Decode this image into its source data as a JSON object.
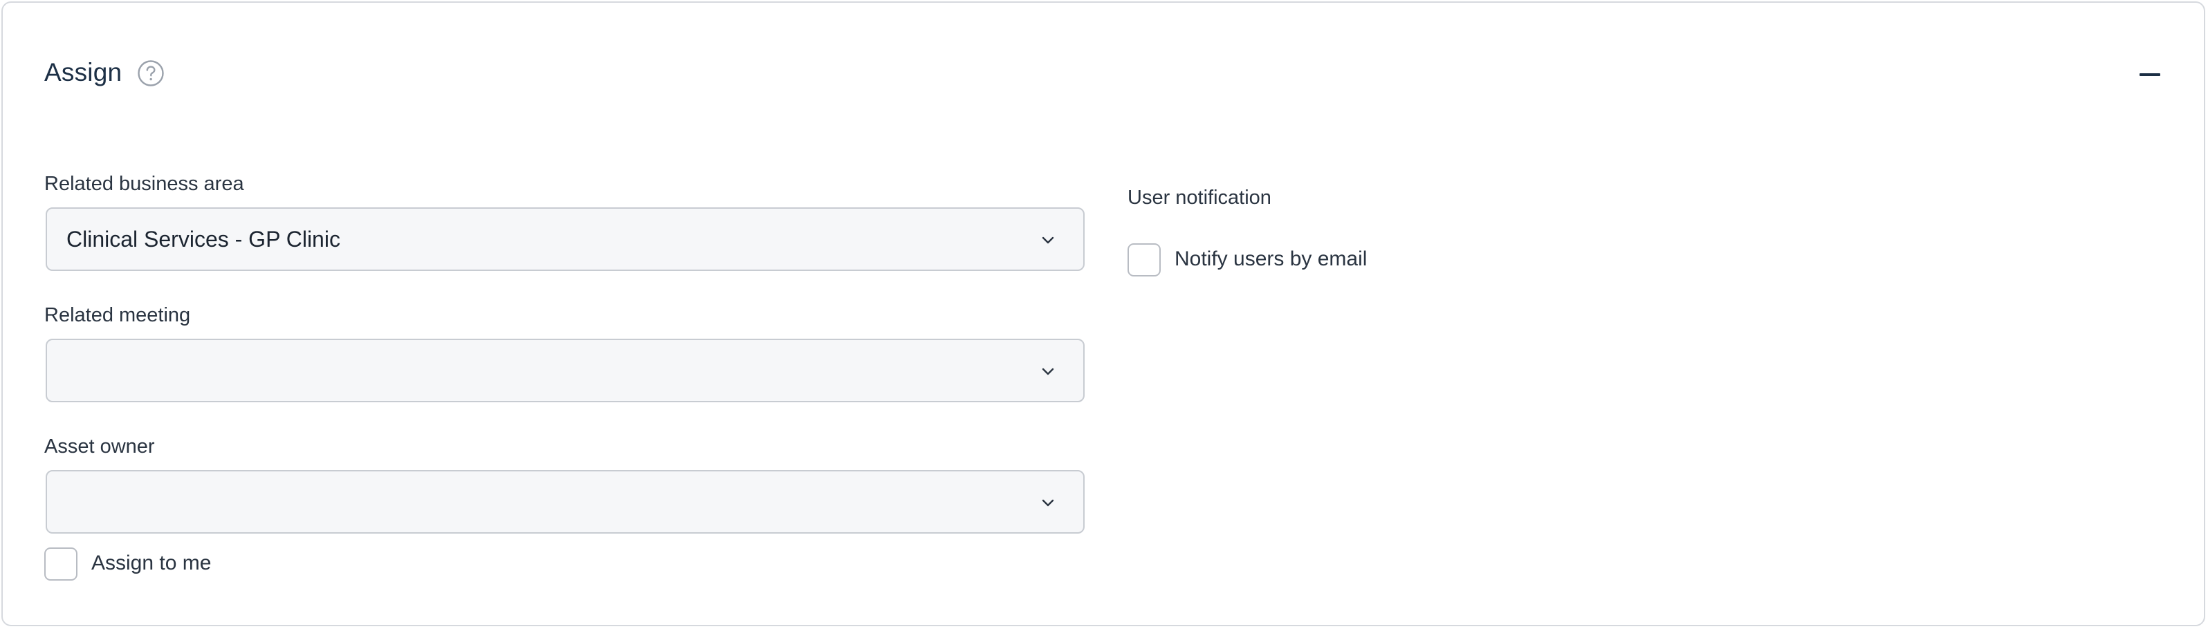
{
  "section": {
    "title": "Assign"
  },
  "fields": {
    "business_area": {
      "label": "Related business area",
      "value": "Clinical Services - GP Clinic"
    },
    "meeting": {
      "label": "Related meeting",
      "value": ""
    },
    "asset_owner": {
      "label": "Asset owner",
      "value": ""
    },
    "assign_to_me": {
      "label": "Assign to me",
      "checked": false
    }
  },
  "notification": {
    "label": "User notification",
    "notify_email": {
      "label": "Notify users by email",
      "checked": false
    }
  },
  "icons": {
    "help": "help-circle-icon",
    "collapse": "minus-icon",
    "dropdown": "chevron-down-icon"
  },
  "colors": {
    "title": "#1c2f45",
    "border": "#c8ccd2",
    "field_bg": "#f6f7f9",
    "panel_border": "#d6d9de"
  }
}
